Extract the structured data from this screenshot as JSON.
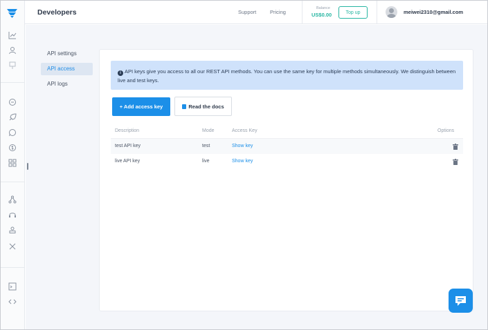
{
  "header": {
    "title": "Developers",
    "links": [
      "Support",
      "Pricing"
    ],
    "balance_label": "Balance",
    "balance_value": "US$0.00",
    "topup_label": "Top up",
    "user_email": "meiwei2310@gmail.com"
  },
  "sidebar_icons": [
    "logo-icon",
    "chart-icon",
    "user-icon",
    "pin-icon",
    "chat-bubble-icon",
    "rocket-icon",
    "whatsapp-icon",
    "dollar-icon",
    "apps-icon",
    "network-icon",
    "headset-icon",
    "contact-icon",
    "tools-icon",
    "terminal-icon",
    "code-icon"
  ],
  "subnav": {
    "items": [
      "API settings",
      "API access",
      "API logs"
    ],
    "active_index": 1
  },
  "info": {
    "text": "API keys give you access to all our REST API methods. You can use the same key for multiple methods simultaneously. We distinguish between live and test keys."
  },
  "actions": {
    "add_label": "+ Add access key",
    "docs_label": "Read the docs"
  },
  "table": {
    "headers": [
      "Description",
      "Mode",
      "Access Key",
      "Options"
    ],
    "rows": [
      {
        "description": "test API key",
        "mode": "test",
        "access_key": "Show key"
      },
      {
        "description": "live API key",
        "mode": "live",
        "access_key": "Show key"
      }
    ]
  },
  "colors": {
    "accent": "#1c8fe8",
    "balance": "#27b6a2",
    "info_bg": "#cfe2fb",
    "active_nav_bg": "#dde6f2"
  }
}
